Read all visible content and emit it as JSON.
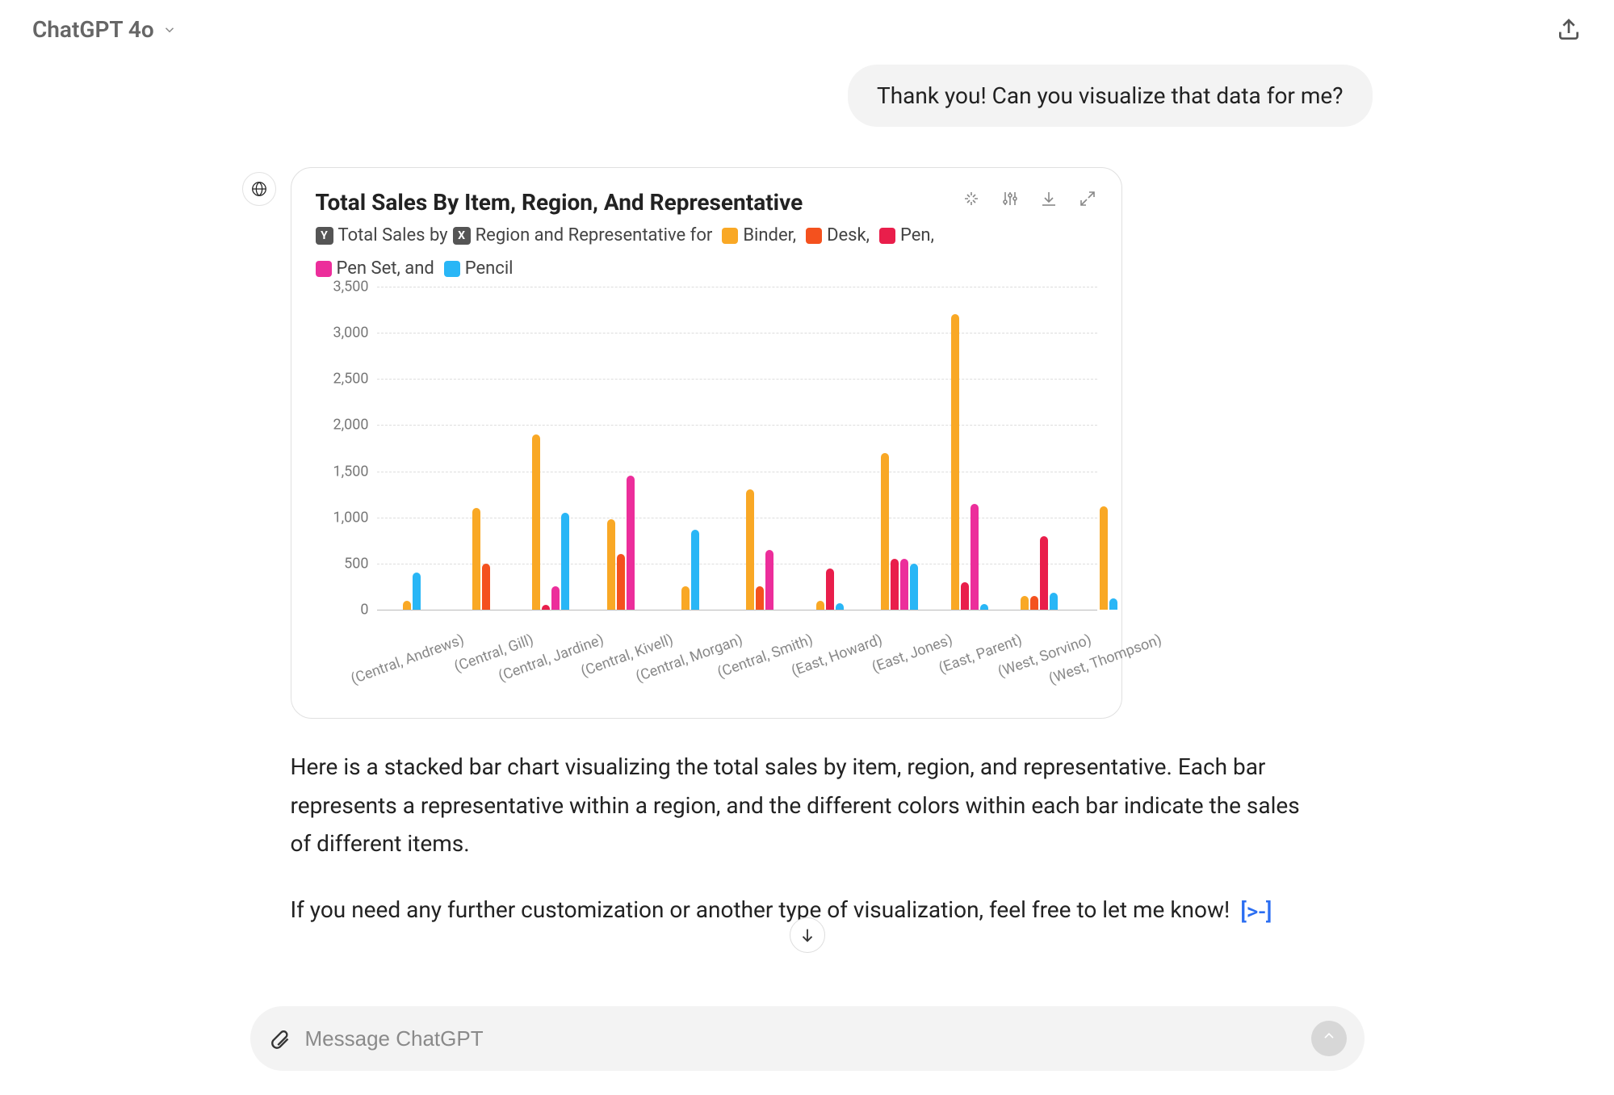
{
  "header": {
    "model_label": "ChatGPT 4o"
  },
  "conversation": {
    "user_message": "Thank you! Can you visualize that data for me?",
    "assistant_paragraph_1": "Here is a stacked bar chart visualizing the total sales by item, region, and representative. Each bar represents a representative within a region, and the different colors within each bar indicate the sales of different items.",
    "assistant_paragraph_2": "If you need any further customization or another type of visualization, feel free to let me know!"
  },
  "chart_card": {
    "title": "Total Sales By Item, Region, And Representative",
    "legend_prefix_y": "Total Sales by",
    "legend_prefix_x": "Region and Representative for",
    "legend_axis_y": "Y",
    "legend_axis_x": "X",
    "legend_binder": "Binder,",
    "legend_desk": "Desk,",
    "legend_pen": "Pen,",
    "legend_penset": "Pen Set, and",
    "legend_pencil": "Pencil",
    "y_ticks": [
      "0",
      "500",
      "1,000",
      "1,500",
      "2,000",
      "2,500",
      "3,000",
      "3,500"
    ]
  },
  "composer": {
    "placeholder": "Message ChatGPT"
  },
  "colors": {
    "binder": "#f9a825",
    "desk": "#f4511e",
    "pen": "#e91e4b",
    "penset": "#ec2e9b",
    "pencil": "#29b6f6"
  },
  "chart_data": {
    "type": "bar",
    "title": "Total Sales By Item, Region, And Representative",
    "xlabel": "Region and Representative",
    "ylabel": "Total Sales",
    "ylim": [
      0,
      3500
    ],
    "categories": [
      "(Central, Andrews)",
      "(Central, Gill)",
      "(Central, Jardine)",
      "(Central, Kivell)",
      "(Central, Morgan)",
      "(Central, Smith)",
      "(East, Howard)",
      "(East, Jones)",
      "(East, Parent)",
      "(West, Sorvino)",
      "(West, Thompson)"
    ],
    "series": [
      {
        "name": "Binder",
        "color": "#f9a825",
        "values": [
          100,
          1100,
          1900,
          980,
          250,
          1300,
          100,
          1700,
          3200,
          150,
          1120
        ]
      },
      {
        "name": "Desk",
        "color": "#f4511e",
        "values": [
          0,
          500,
          0,
          600,
          0,
          250,
          0,
          0,
          0,
          150,
          0
        ]
      },
      {
        "name": "Pen",
        "color": "#e91e4b",
        "values": [
          0,
          0,
          50,
          0,
          0,
          0,
          450,
          550,
          300,
          800,
          0
        ]
      },
      {
        "name": "Pen Set",
        "color": "#ec2e9b",
        "values": [
          0,
          0,
          250,
          1450,
          0,
          650,
          0,
          550,
          1150,
          0,
          0
        ]
      },
      {
        "name": "Pencil",
        "color": "#29b6f6",
        "values": [
          400,
          0,
          1050,
          0,
          870,
          0,
          70,
          500,
          60,
          180,
          120
        ]
      }
    ]
  }
}
